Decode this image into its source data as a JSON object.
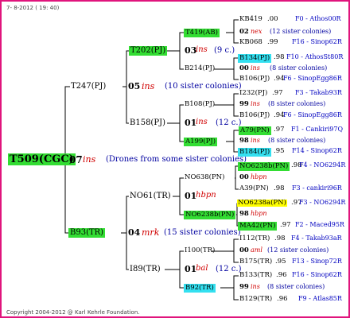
{
  "header": "7-  8-2012 ( 19: 40)",
  "footer": "Copyright 2004-2012 @ Karl Kehrle Foundation.",
  "root": {
    "id": "T509(CGC)",
    "gen": "07",
    "note": "ins",
    "desc": "(Drones from some sister colonies)"
  },
  "l1": [
    {
      "id": "T247(PJ)",
      "gen": "05",
      "note": "ins",
      "sis": "(10 sister colonies)"
    },
    {
      "id": "B93(TR)",
      "gen": "04",
      "note": "mrk",
      "sis": "(15 sister colonies)"
    }
  ],
  "l2": [
    {
      "id": "T202(PJ)",
      "gen": "03",
      "note": "ins",
      "sis": "(9 c.)"
    },
    {
      "id": "B158(PJ)",
      "gen": "01",
      "note": "ins",
      "sis": "(12 c.)"
    },
    {
      "id": "NO61(TR)",
      "gen": "01",
      "note": "hbpn",
      "sis": ""
    },
    {
      "id": "I89(TR)",
      "gen": "01",
      "note": "bal",
      "sis": "(12 c.)"
    }
  ],
  "l3": [
    {
      "id": "T419(AB)",
      "gen": "02",
      "note": "nex",
      "sis": "(12 sister colonies)"
    },
    {
      "id": "B214(PJ)",
      "gen": "00",
      "note": "ins",
      "sis": "(8 sister colonies)"
    },
    {
      "id": "B108(PJ)",
      "gen": "99",
      "note": "ins",
      "sis": "(8 sister colonies)"
    },
    {
      "id": "A199(PJ)",
      "gen": "98",
      "note": "ins",
      "sis": "(8 sister colonies)"
    },
    {
      "id": "NO638(PN)",
      "gen": "00",
      "note": "hbpn",
      "sis": ""
    },
    {
      "id": "NO6238b(PN)",
      "gen": "98",
      "note": "hbpn",
      "sis": ""
    },
    {
      "id": "I100(TR)",
      "gen": "00",
      "note": "aml",
      "sis": "(12 sister colonies)"
    },
    {
      "id": "B92(TR)",
      "gen": "99",
      "note": "ins",
      "sis": "(8 sister colonies)"
    }
  ],
  "l4": [
    {
      "id": "KB419",
      "yr": ".00",
      "right": "F0 - Athos00R"
    },
    {
      "id": "KB068",
      "yr": ".99",
      "right": "F16 - Sinop62R"
    },
    {
      "id": "B134(PJ)",
      "yr": ".98",
      "right": "F10 - AthosSt80R"
    },
    {
      "id": "B106(PJ)",
      "yr": ".94",
      "right": "F6 - SinopEgg86R"
    },
    {
      "id": "I232(PJ)",
      "yr": ".97",
      "right": "F3 - Takab93R"
    },
    {
      "id": "B106(PJ)",
      "yr": ".94",
      "right": "F6 - SinopEgg86R"
    },
    {
      "id": "A79(PN)",
      "yr": ".97",
      "right": "F1 - Cankiri97Q"
    },
    {
      "id": "B184(PJ)",
      "yr": ".95",
      "right": "F14 - Sinop62R"
    },
    {
      "id": "NO6238b(PN)",
      "yr": ".98",
      "right": "F4 - NO6294R"
    },
    {
      "id": "A39(PN)",
      "yr": ".98",
      "right": "F3 - cankiri96R"
    },
    {
      "id": "NO6238a(PN)",
      "yr": ".97",
      "right": "F3 - NO6294R"
    },
    {
      "id": "MA42(PN)",
      "yr": ".97",
      "right": "F2 - Maced95R"
    },
    {
      "id": "I112(TR)",
      "yr": ".98",
      "right": "F4 - Takab93aR"
    },
    {
      "id": "B175(TR)",
      "yr": ".95",
      "right": "F13 - Sinop72R"
    },
    {
      "id": "B133(TR)",
      "yr": ".96",
      "right": "F16 - Sinop62R"
    },
    {
      "id": "B129(TR)",
      "yr": ".96",
      "right": "F9 - Atlas85R"
    }
  ]
}
